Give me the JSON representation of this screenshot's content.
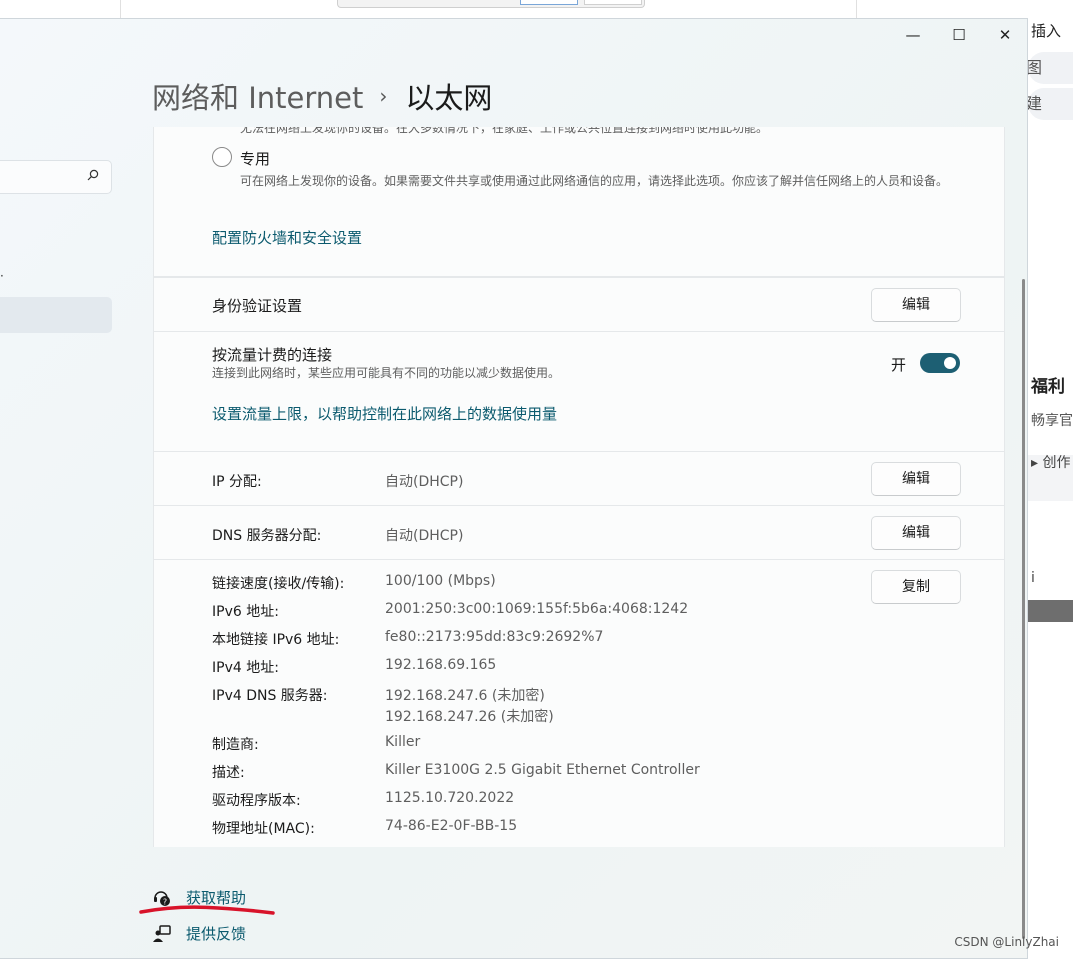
{
  "background": {
    "right_pills": [
      "图",
      "建"
    ],
    "right_texts": [
      "插入",
      "福利",
      "畅享官",
      "▸ 创作",
      "i"
    ]
  },
  "window": {
    "controls": {
      "minimize": "—",
      "maximize": "☐",
      "close": "✕"
    }
  },
  "breadcrumb": {
    "parent": "网络和 Internet",
    "separator": "›",
    "current": "以太网"
  },
  "network_profile": {
    "public_desc_partial": "无法在网络上发现你的设备。在大多数情况下，在家庭、工作或公共位置连接到网络时使用此功能。",
    "private_label": "专用",
    "private_desc": "可在网络上发现你的设备。如果需要文件共享或使用通过此网络通信的应用，请选择此选项。你应该了解并信任网络上的人员和设备。",
    "firewall_link": "配置防火墙和安全设置"
  },
  "auth": {
    "label": "身份验证设置",
    "button": "编辑"
  },
  "metered": {
    "label": "按流量计费的连接",
    "desc": "连接到此网络时，某些应用可能具有不同的功能以减少数据使用。",
    "state_text": "开",
    "enabled": true,
    "data_limit_link": "设置流量上限，以帮助控制在此网络上的数据使用量"
  },
  "ip_assignment": {
    "label": "IP 分配:",
    "value": "自动(DHCP)",
    "button": "编辑"
  },
  "dns_assignment": {
    "label": "DNS 服务器分配:",
    "value": "自动(DHCP)",
    "button": "编辑"
  },
  "properties": {
    "copy_button": "复制",
    "rows": [
      {
        "key": "链接速度(接收/传输):",
        "value": "100/100 (Mbps)"
      },
      {
        "key": "IPv6 地址:",
        "value": "2001:250:3c00:1069:155f:5b6a:4068:1242"
      },
      {
        "key": "本地链接 IPv6 地址:",
        "value": "fe80::2173:95dd:83c9:2692%7"
      },
      {
        "key": "IPv4 地址:",
        "value": "192.168.69.165"
      },
      {
        "key": "IPv4 DNS 服务器:",
        "value": "192.168.247.6 (未加密)",
        "value2": "192.168.247.26 (未加密)"
      },
      {
        "key": "制造商:",
        "value": "Killer"
      },
      {
        "key": "描述:",
        "value": "Killer E3100G 2.5 Gigabit Ethernet Controller"
      },
      {
        "key": "驱动程序版本:",
        "value": "1125.10.720.2022"
      },
      {
        "key": "物理地址(MAC):",
        "value": "74-86-E2-0F-BB-15"
      }
    ]
  },
  "footer": {
    "get_help": "获取帮助",
    "feedback": "提供反馈"
  },
  "watermark": "CSDN @LinlyZhai",
  "colors": {
    "accent": "#1d5f73",
    "link": "#0b5a6e",
    "annotation": "#d8132a"
  }
}
